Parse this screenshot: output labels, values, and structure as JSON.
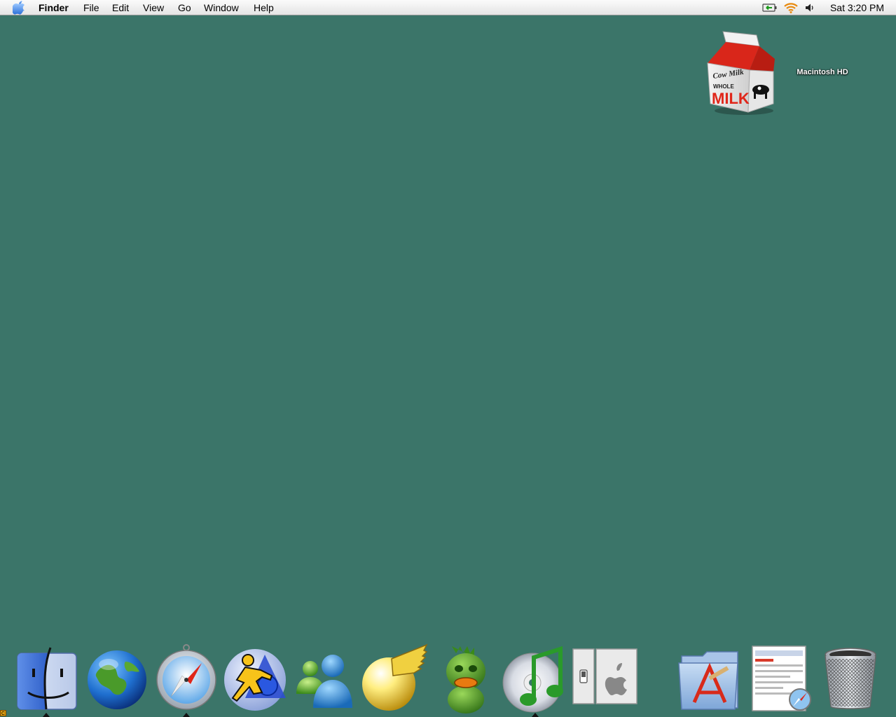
{
  "menubar": {
    "app_name": "Finder",
    "menus": [
      "File",
      "Edit",
      "View",
      "Go",
      "Window",
      "Help"
    ],
    "clock": "Sat 3:20 PM",
    "status_icons": [
      "battery-icon",
      "wifi-icon",
      "volume-icon"
    ]
  },
  "desktop": {
    "background_color": "#3b7569",
    "icons": [
      {
        "label": "Macintosh HD",
        "icon": "milk-carton-drive-icon"
      }
    ]
  },
  "dock": {
    "items": [
      {
        "name": "finder-icon",
        "running": true
      },
      {
        "name": "globe-icon",
        "running": false
      },
      {
        "name": "safari-compass-icon",
        "running": true
      },
      {
        "name": "aim-running-man-icon",
        "running": false
      },
      {
        "name": "messenger-buddies-icon",
        "running": false
      },
      {
        "name": "yellow-winged-ball-icon",
        "running": false
      },
      {
        "name": "green-duck-icon",
        "running": false
      },
      {
        "name": "itunes-icon",
        "running": true
      },
      {
        "name": "system-preferences-switch-icon",
        "running": false
      },
      {
        "name": "applications-folder-icon",
        "running": false
      },
      {
        "name": "web-page-document-icon",
        "running": false
      },
      {
        "name": "trash-icon",
        "running": false
      }
    ]
  }
}
